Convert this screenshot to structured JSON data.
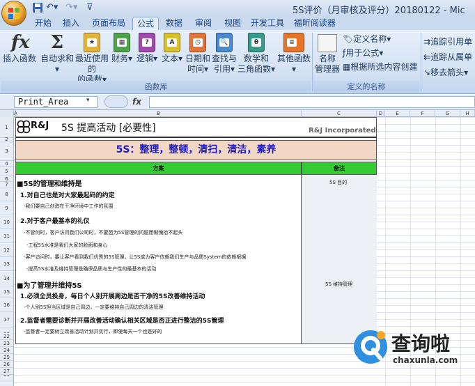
{
  "window": {
    "title": "5S评价（月审核及评分）20180122 - Mic"
  },
  "tabs": [
    {
      "label": "开始"
    },
    {
      "label": "插入"
    },
    {
      "label": "页面布局"
    },
    {
      "label": "公式",
      "active": true
    },
    {
      "label": "数据"
    },
    {
      "label": "审阅"
    },
    {
      "label": "视图"
    },
    {
      "label": "开发工具"
    },
    {
      "label": "福昕阅读器"
    }
  ],
  "ribbon": {
    "insert_function": "插入函数",
    "autosum": [
      "自动求和"
    ],
    "recent": [
      "最近使用的",
      "的函数"
    ],
    "finance": "财务",
    "logic": "逻辑",
    "text": "文本",
    "datetime": [
      "日期和",
      "时间"
    ],
    "lookup": [
      "查找与",
      "引用"
    ],
    "math": [
      "数学和",
      "三角函数"
    ],
    "other": "其他函数",
    "group_library": "函数库",
    "name_manager": [
      "名称",
      "管理器"
    ],
    "define_name": "定义名称",
    "use_in_formula": "用于公式",
    "create_from_selection": "根据所选内容创建",
    "group_names": "定义的名称",
    "trace_precedents": "追踪引用单",
    "trace_dependents": "追踪从属单",
    "remove_arrows": "移去箭头"
  },
  "formula_bar": {
    "name_box": "Print_Area",
    "fx": "fx",
    "value": ""
  },
  "columns": [
    "A",
    "B",
    "C",
    "D",
    "E",
    "F",
    "G",
    "H"
  ],
  "rows": [
    "1",
    "2",
    "3",
    "4",
    "5",
    "6",
    "7",
    "8",
    "9",
    "10",
    "11",
    "12",
    "13",
    "14",
    "15",
    "16",
    "17",
    "18",
    "19",
    "20",
    "21",
    "22",
    "23",
    "24",
    "25",
    "26",
    "27"
  ],
  "sheet": {
    "logo": "R&J",
    "title": "5S 提高活动  [必要性]",
    "company": "R&J Incorporated",
    "banner": "5S：整理，整顿，清扫，清洁，素养",
    "col_plan": "方案",
    "col_note": "备注",
    "sec1": "■5S的管理和维持是",
    "sec1_note": "5S 目的",
    "s1_h1": "1.对自己也是对大家最起码的约定",
    "s1_l1": "-我们要自己创造在干净环境中工作的氛围",
    "s1_h2": "2.对于客户最基本的礼仪",
    "s1_l2": "-不管何时，客户访问我们公司时，不要因为5S管理的问题而惭愧抬不起头",
    "s1_l3": "-工程5S水准是我们大家的脸面和身心",
    "s1_l4": "-客户访问时，要让客户看到我们优秀的5S管理，让5S成为客户信赖我们生产与品质System的依赖根据",
    "s1_l5": "-提高5S水准及维持管理是确保品质与生产性的最基本的活动",
    "sec2": "■为了管理并维持5S",
    "sec2_note": "5S 维持管理",
    "s2_h1": "1.必须全员投身，每日个人别开展周边是否干净的5S改善维持活动",
    "s2_l1": "-个人别5S担当区域是自己周边，一定要维持自己周边的清洁管理",
    "s2_h2": "2.监督者需要诊断并开展改善活动确认相关区域是否正进行整洁的5S管理",
    "s2_l2": "-监督者一定要树立改善活动计划并实行，即使每天一个也是好的"
  },
  "watermark": {
    "text": "查询啦",
    "url": "chaxunla.com"
  },
  "colors": {
    "accent_tab": "#e3ecf8",
    "header_green": "#33cc33",
    "banner_bg": "#f1d7c4",
    "banner_text": "#1a1acc"
  }
}
